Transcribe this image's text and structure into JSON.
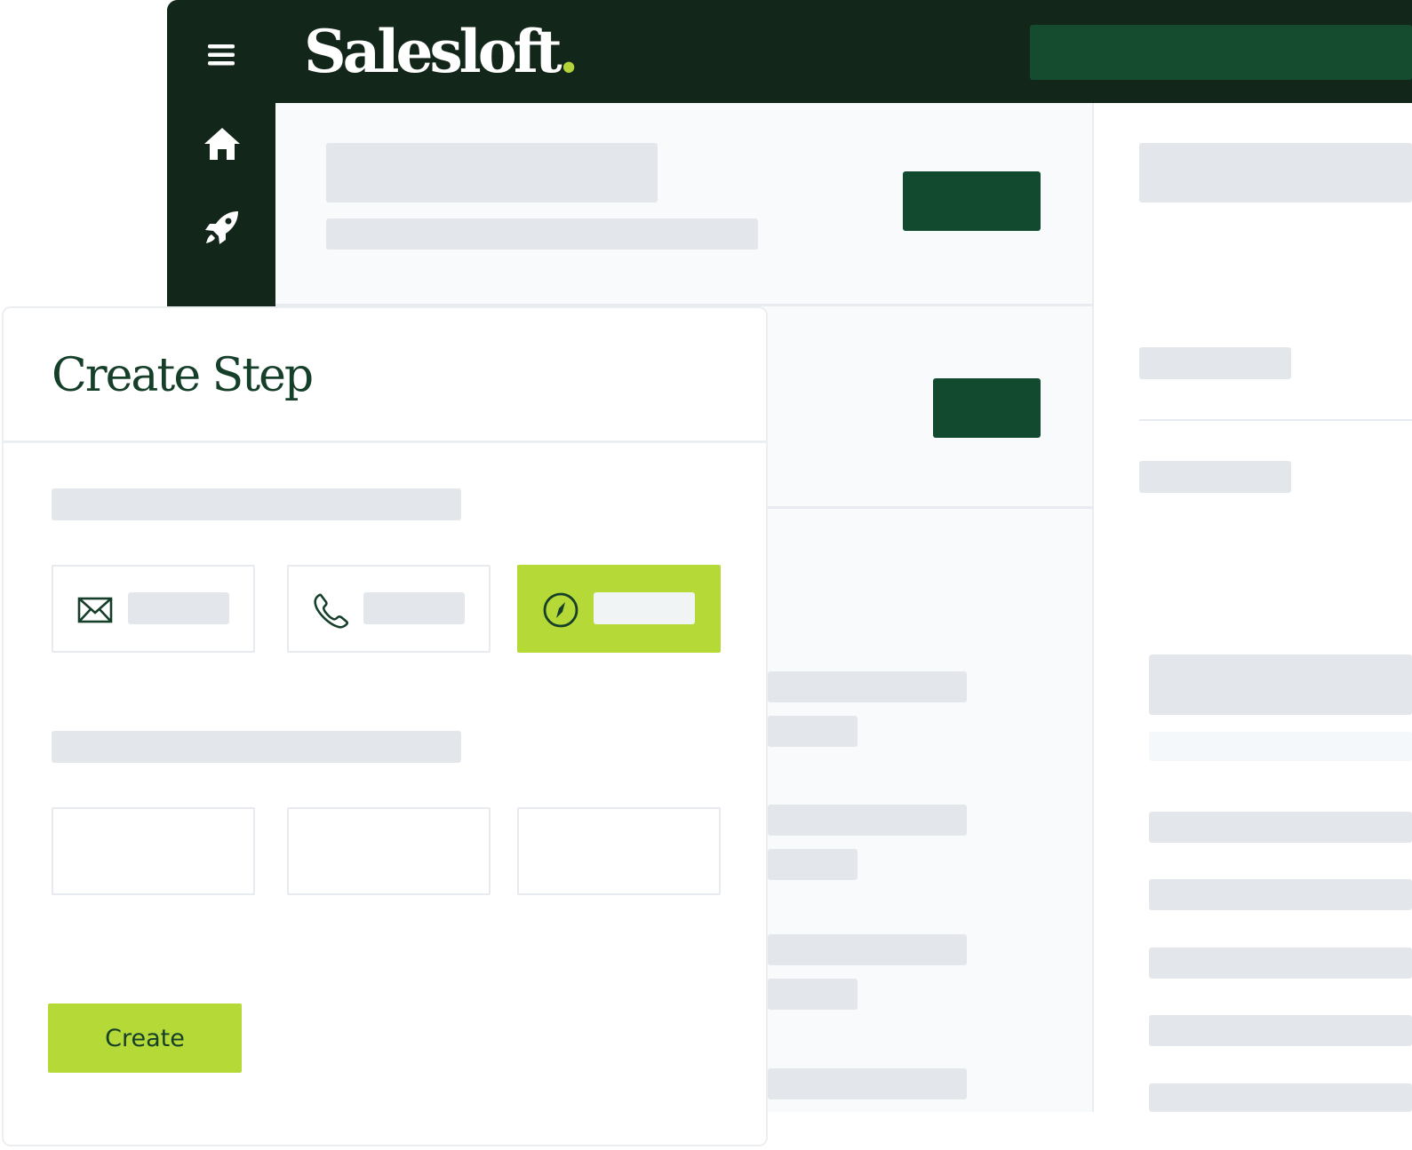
{
  "app": {
    "logo_text": "Salesloft",
    "logo_dot": ".",
    "brand_dark": "#12261a",
    "brand_green": "#114a2e",
    "accent_lime": "#b5d936",
    "sidebar_icons": [
      "menu-icon",
      "home-icon",
      "rocket-icon"
    ]
  },
  "modal": {
    "title": "Create Step",
    "step_types": [
      {
        "icon": "email-icon",
        "active": false
      },
      {
        "icon": "phone-icon",
        "active": false
      },
      {
        "icon": "compass-icon",
        "active": true
      }
    ],
    "create_label": "Create"
  }
}
